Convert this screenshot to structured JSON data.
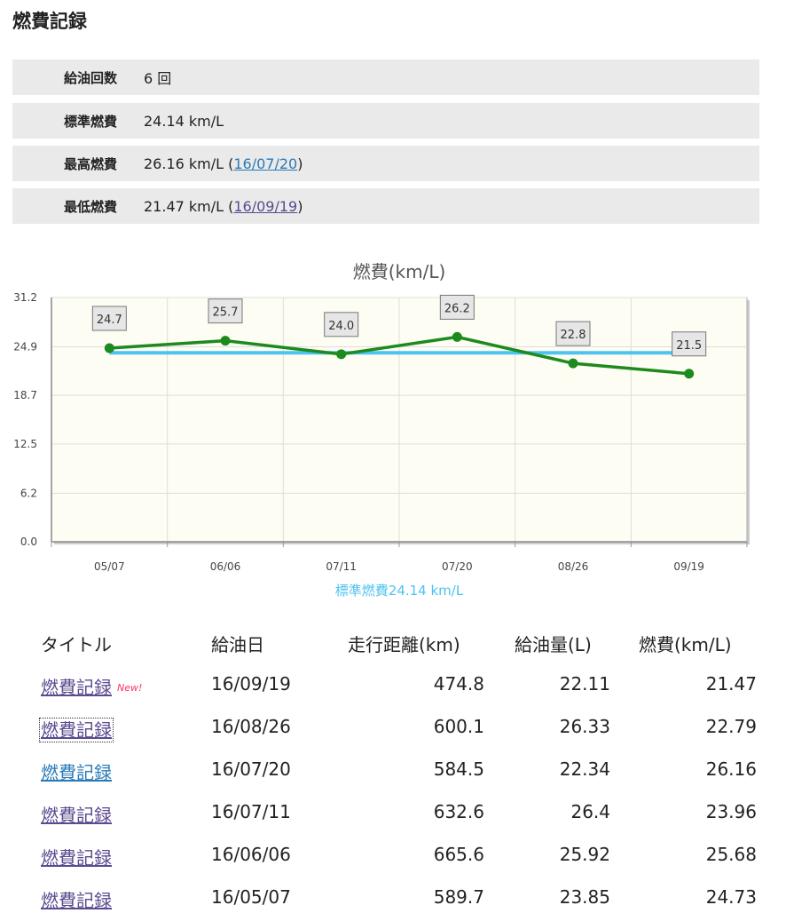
{
  "page": {
    "title": "燃費記録"
  },
  "summary": [
    {
      "label": "給油回数",
      "value": "6 回"
    },
    {
      "label": "標準燃費",
      "value": "24.14 km/L"
    },
    {
      "label": "最高燃費",
      "value": "26.16 km/L (",
      "link": "16/07/20",
      "suffix": ")"
    },
    {
      "label": "最低燃費",
      "value": "21.47 km/L (",
      "link": "16/09/19",
      "suffix": ")"
    }
  ],
  "colors": {
    "series": "#1c8a1c",
    "standard": "#4dc3ef",
    "plot_bg": "#fefdf3",
    "link": "#2a7ab8",
    "link_visited": "#5b4a8f",
    "new_badge": "#ff3366"
  },
  "chart_data": {
    "type": "line",
    "title": "燃費(km/L)",
    "categories": [
      "05/07",
      "06/06",
      "07/11",
      "07/20",
      "08/26",
      "09/19"
    ],
    "series": [
      {
        "values": [
          24.73,
          25.68,
          23.96,
          26.16,
          22.79,
          21.47
        ],
        "labels": [
          "24.7",
          "25.7",
          "24.0",
          "26.2",
          "22.8",
          "21.5"
        ]
      }
    ],
    "reference_line": {
      "value": 24.14,
      "label": "標準燃費24.14 km/L"
    },
    "ylim": [
      0,
      31.2
    ],
    "yticks": [
      "0.0",
      "6.2",
      "12.5",
      "18.7",
      "24.9",
      "31.2"
    ],
    "grid": true
  },
  "table": {
    "headers": {
      "title": "タイトル",
      "date": "給油日",
      "distance": "走行距離(km)",
      "fuel": "給油量(L)",
      "efficiency": "燃費(km/L)"
    },
    "new_badge": "New!",
    "rows": [
      {
        "title": "燃費記録",
        "date": "16/09/19",
        "distance": "474.8",
        "fuel": "22.11",
        "efficiency": "21.47"
      },
      {
        "title": "燃費記録",
        "date": "16/08/26",
        "distance": "600.1",
        "fuel": "26.33",
        "efficiency": "22.79"
      },
      {
        "title": "燃費記録",
        "date": "16/07/20",
        "distance": "584.5",
        "fuel": "22.34",
        "efficiency": "26.16"
      },
      {
        "title": "燃費記録",
        "date": "16/07/11",
        "distance": "632.6",
        "fuel": "26.4",
        "efficiency": "23.96"
      },
      {
        "title": "燃費記録",
        "date": "16/06/06",
        "distance": "665.6",
        "fuel": "25.92",
        "efficiency": "25.68"
      },
      {
        "title": "燃費記録",
        "date": "16/05/07",
        "distance": "589.7",
        "fuel": "23.85",
        "efficiency": "24.73"
      }
    ]
  }
}
